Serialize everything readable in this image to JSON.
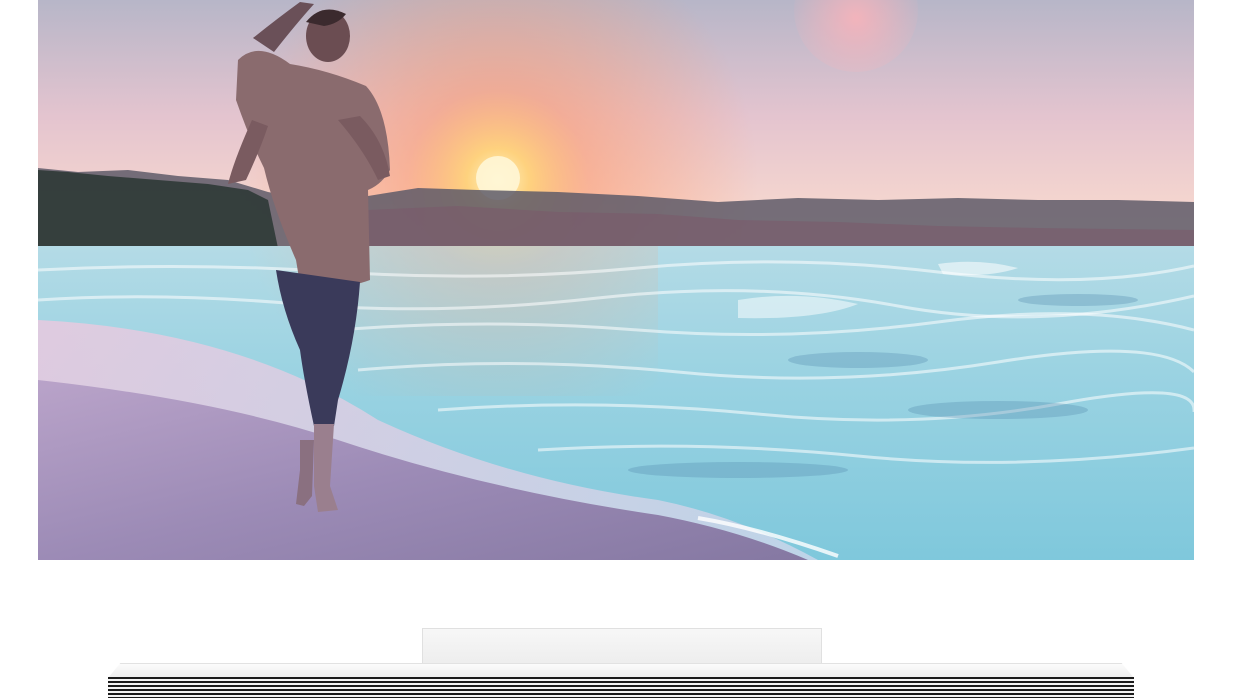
{
  "scene": {
    "subject": "woman-walking-on-beach",
    "colors": {
      "sky_top": "#b9b7c9",
      "sky_mid": "#f2c3c8",
      "sun": "#ffd27a",
      "horizon_glow": "#ff9a6b",
      "hills": "#5b4f66",
      "sea": "#8fd3e0",
      "sea_deep": "#5aa9c6",
      "foam": "#e8f7fb",
      "sand": "#8b7fa8",
      "sand_light": "#c7a9c6",
      "silhouette": "#3a2f45"
    }
  },
  "device": {
    "type": "tv-with-soundbar-stand",
    "bezel_color": "#ffffff",
    "stand_color": "#efefef",
    "speaker_grille_color": "#1b1b1b"
  }
}
